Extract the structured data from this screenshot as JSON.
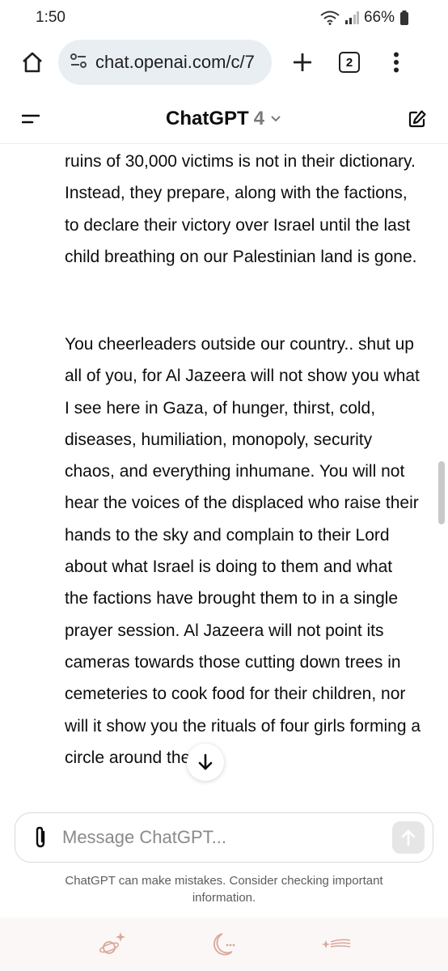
{
  "status": {
    "time": "1:50",
    "battery": "66%"
  },
  "browser": {
    "url": "chat.openai.com/c/7",
    "tab_count": "2"
  },
  "header": {
    "title": "ChatGPT",
    "model": "4"
  },
  "messages": [
    "ruins of 30,000 victims is not in their dictionary. Instead, they prepare, along with the factions, to declare their victory over Israel until the last child breathing on our Palestinian land is gone.",
    "You cheerleaders outside our country.. shut up all of you, for Al Jazeera will not show you what I see here in Gaza, of hunger, thirst, cold, diseases, humiliation, monopoly, security chaos, and everything inhumane. You will not hear the voices of the displaced who raise their hands to the sky and complain to their Lord about what Israel is doing to them and what the factions have brought them to in a single prayer session. Al Jazeera will not point its cameras towards those cutting down trees in cemeteries to cook food for their children, nor will it show you the rituals of four girls forming a circle around their"
  ],
  "composer": {
    "placeholder": "Message ChatGPT..."
  },
  "disclaimer": "ChatGPT can make mistakes. Consider checking important information.",
  "colors": {
    "accent": "#0d0d0d",
    "nav_icon": "#d9a79a"
  }
}
